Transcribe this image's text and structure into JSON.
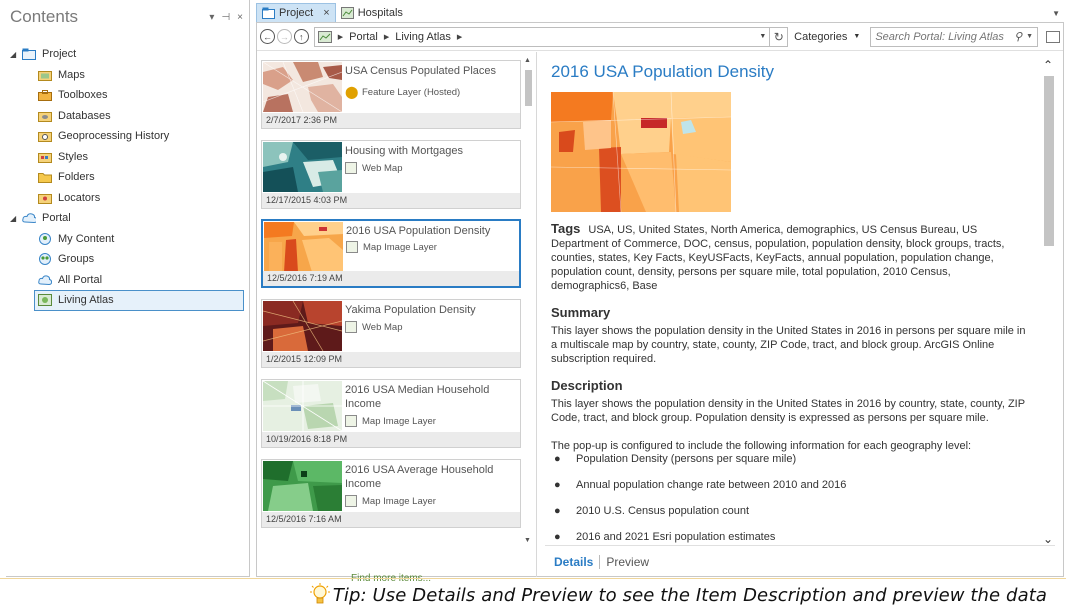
{
  "contents": {
    "title": "Contents",
    "controls": [
      "▾",
      "⊣",
      "×"
    ],
    "tree": [
      {
        "label": "Project",
        "level": 0,
        "expanded": true,
        "icon": "project-folder-icon"
      },
      {
        "label": "Maps",
        "level": 1,
        "icon": "maps-icon"
      },
      {
        "label": "Toolboxes",
        "level": 1,
        "icon": "toolboxes-icon"
      },
      {
        "label": "Databases",
        "level": 1,
        "icon": "databases-icon"
      },
      {
        "label": "Geoprocessing History",
        "level": 1,
        "icon": "geoprocessing-history-icon"
      },
      {
        "label": "Styles",
        "level": 1,
        "icon": "styles-icon"
      },
      {
        "label": "Folders",
        "level": 1,
        "icon": "folders-icon"
      },
      {
        "label": "Locators",
        "level": 1,
        "icon": "locators-icon"
      },
      {
        "label": "Portal",
        "level": 0,
        "expanded": true,
        "icon": "portal-cloud-icon"
      },
      {
        "label": "My Content",
        "level": 1,
        "icon": "my-content-icon"
      },
      {
        "label": "Groups",
        "level": 1,
        "icon": "groups-icon"
      },
      {
        "label": "All Portal",
        "level": 1,
        "icon": "all-portal-cloud-icon"
      },
      {
        "label": "Living Atlas",
        "level": 1,
        "icon": "living-atlas-icon",
        "selected": true
      }
    ]
  },
  "tabs": [
    {
      "label": "Project",
      "active": true,
      "close": "×"
    },
    {
      "label": "Hospitals",
      "active": false
    }
  ],
  "toolbar": {
    "breadcrumb": [
      "Portal",
      "Living Atlas"
    ],
    "categories_label": "Categories",
    "search_placeholder": "Search Portal: Living Atlas"
  },
  "gallery": {
    "items": [
      {
        "title": "USA Census Populated Places",
        "type": "Feature Layer (Hosted)",
        "date": "2/7/2017 2:36 PM"
      },
      {
        "title": "Housing with Mortgages",
        "type": "Web Map",
        "date": "12/17/2015 4:03 PM"
      },
      {
        "title": "2016 USA Population Density",
        "type": "Map Image Layer",
        "date": "12/5/2016 7:19 AM",
        "selected": true
      },
      {
        "title": "Yakima Population Density",
        "type": "Web Map",
        "date": "1/2/2015 12:09 PM"
      },
      {
        "title": "2016 USA Median Household Income",
        "type": "Map Image Layer",
        "date": "10/19/2016 8:18 PM"
      },
      {
        "title": "2016 USA Average Household Income",
        "type": "Map Image Layer",
        "date": "12/5/2016 7:16 AM"
      }
    ],
    "find_more": "Find more items..."
  },
  "details": {
    "title": "2016 USA Population Density",
    "tags_label": "Tags",
    "tags": "USA, US, United States, North America, demographics, US Census Bureau, US Department of Commerce, DOC, census, population, population density, block groups, tracts, counties, states, Key Facts, KeyUSFacts, KeyFacts, annual population, population change, population count, density, persons per square mile, total population, 2010 Census, demographics6, Base",
    "summary_heading": "Summary",
    "summary": "This layer shows the population density in the United States in 2016 in persons per square mile in a multiscale map by country, state, county, ZIP Code, tract, and block group. ArcGIS Online subscription required.",
    "description_heading": "Description",
    "description": "This layer shows the population density in the United States in 2016 by country, state, county, ZIP Code, tract, and block group. Population density is expressed as persons per square mile.",
    "popup_intro": "The pop-up is configured to include the following information for each geography level:",
    "bullets": [
      "Population Density (persons per square mile)",
      "Annual population change rate between 2010 and 2016",
      "2010 U.S. Census population count",
      "2016 and 2021 Esri population estimates"
    ],
    "tab_details": "Details",
    "tab_preview": "Preview"
  },
  "tip": {
    "text": "Tip: Use Details and Preview to see the Item Description and preview the data"
  },
  "colors": {
    "accent": "#2a7cc4",
    "selection": "#e6f1fa",
    "link_green": "#5a8a3a"
  }
}
